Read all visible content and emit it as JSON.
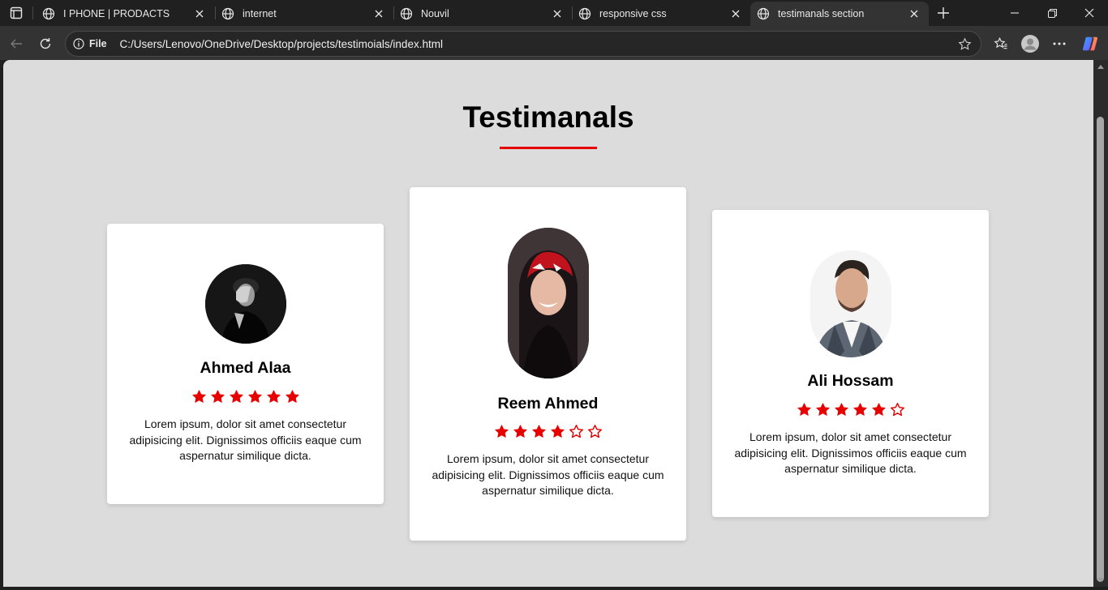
{
  "browser": {
    "tabs": [
      {
        "title": "I PHONE | PRODACTS",
        "active": false
      },
      {
        "title": "internet",
        "active": false
      },
      {
        "title": "Nouvil",
        "active": false
      },
      {
        "title": "responsive css",
        "active": false
      },
      {
        "title": "testimanals section",
        "active": true
      }
    ],
    "site_info_label": "File",
    "url": "C:/Users/Lenovo/OneDrive/Desktop/projects/testimoials/index.html"
  },
  "page": {
    "title": "Testimanals",
    "accent_color": "#e60000",
    "testimonials": [
      {
        "name": "Ahmed Alaa",
        "rating": 6,
        "max_rating": 6,
        "text": "Lorem ipsum, dolor sit amet consectetur adipisicing elit. Dignissimos officiis eaque cum aspernatur similique dicta.",
        "photo": "man-black-and-white-portrait"
      },
      {
        "name": "Reem Ahmed",
        "rating": 4,
        "max_rating": 6,
        "text": "Lorem ipsum, dolor sit amet consectetur adipisicing elit. Dignissimos officiis eaque cum aspernatur similique dicta.",
        "photo": "woman-red-headscarf-portrait"
      },
      {
        "name": "Ali Hossam",
        "rating": 5,
        "max_rating": 6,
        "text": "Lorem ipsum, dolor sit amet consectetur adipisicing elit. Dignissimos officiis eaque cum aspernatur similique dicta.",
        "photo": "man-grey-suit-portrait"
      }
    ]
  }
}
